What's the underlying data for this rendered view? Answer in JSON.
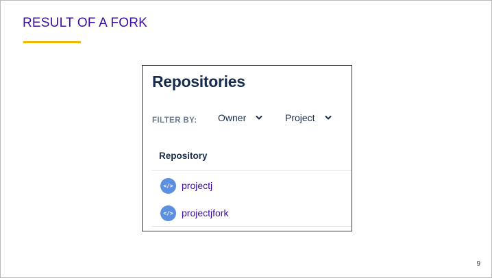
{
  "slide": {
    "title": "RESULT OF A FORK",
    "page_number": "9",
    "accent_color": "#f2b800",
    "title_color": "#3a0ca3"
  },
  "repositories_panel": {
    "heading": "Repositories",
    "filter_label": "FILTER BY:",
    "filters": {
      "owner": "Owner",
      "project": "Project"
    },
    "column_header": "Repository",
    "rows": [
      {
        "icon": "code-icon",
        "icon_glyph": "</>",
        "name": "projectj"
      },
      {
        "icon": "code-icon",
        "icon_glyph": "</>",
        "name": "projectjfork"
      }
    ]
  }
}
